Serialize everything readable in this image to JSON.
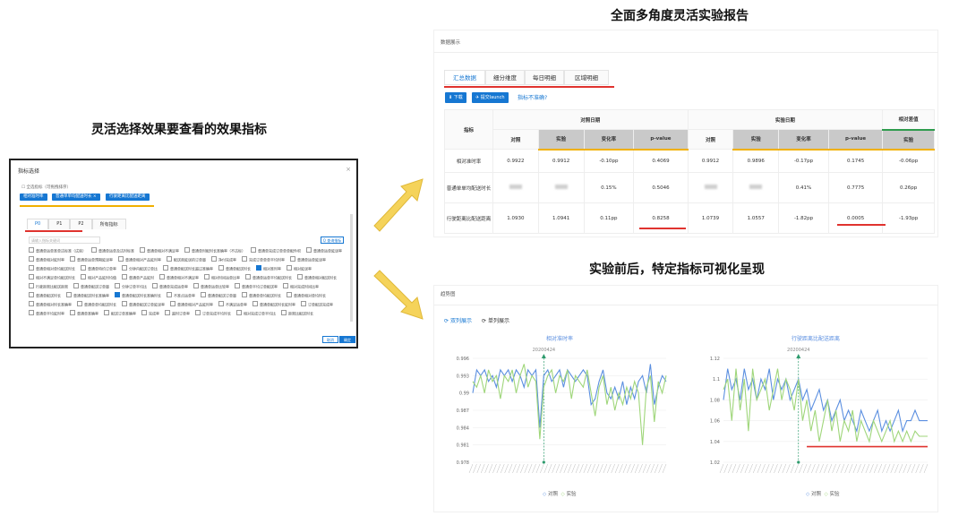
{
  "captions": {
    "left": "灵活选择效果要查看的效果指标",
    "top": "全面多角度灵活实验报告",
    "middle": "实验前后，特定指标可视化呈现"
  },
  "dialog": {
    "title": "指标选择",
    "close": "×",
    "checkbox": "☐ 全选指标（可拖拽排序）",
    "tags": [
      "相对准时率",
      "普通单单均配送时长 ×",
      "行驶距离比配送距离"
    ],
    "tabs": [
      "P0",
      "P1",
      "P2",
      "所有指标"
    ],
    "search_placeholder": "请输入指标关键词",
    "search_button": "Q 查询指标",
    "options": [
      "普通单运单准单达标准（试验）",
      "普通单运单及达时标准",
      "普通单相对不满足率",
      "普通单时配时长准确率（不达标）",
      "普通单完成订单单单配件积",
      "普通单运单延误率",
      "普通单相对延时率",
      "普通单运单预期延误率",
      "普通单相对产品延时率",
      "配送商延误的订单量",
      "净付完成率",
      "完成订单单单平均时率",
      "普通单运单延误率",
      "普通单相对单均配送时长",
      "普通单特约订单率",
      "分钟内配送订单比",
      "普通单配送时长超过准确率",
      "普通单配送时长",
      "相对准时率",
      "相对延误率",
      "相对不满足单均配送时长",
      "相对产品延时均值",
      "普通单产品延时",
      "普通单相对不满足率",
      "相对时间运单比率",
      "普通单运单平均配送时长",
      "普通单相对配送时长",
      "行驶距离比配送距离",
      "普通单配送订单量",
      "分钟订单平均比",
      "普通单完成运单率",
      "普通单运单比较率",
      "普通单平均订单配送率",
      "相对完成时间比率",
      "普通单配送时长",
      "普通单配送时长准确率",
      "普通单配送时长准确时长",
      "不准点运单率",
      "普通单配送订单量",
      "普通单单均配送时长",
      "普通单相对单均时长",
      "普通单相对时长准确率",
      "普通单单均配送时长",
      "普通单配送订单延误率",
      "普通单相对产品延时率",
      "不满足运单率",
      "普通单配送时长延时率",
      "订单配送完成率",
      "普通单平均延时率",
      "普通单准确率",
      "配送订单准确率",
      "完成率",
      "超时订单率",
      "订单完成平均时长",
      "相对完成订单平均比",
      "距离比配送时长"
    ],
    "options_on": [
      18,
      36
    ],
    "cancel": "取消",
    "ok": "确定"
  },
  "report": {
    "section": "数据展示",
    "tabs": [
      "汇总数据",
      "细分维度",
      "每日明细",
      "区域明细"
    ],
    "download": "⬇ 下载",
    "submit": "✈ 提交launch",
    "inaccurate": "指标不准确?",
    "headers": {
      "metric": "指标",
      "group_control": "对照日期",
      "group_exp": "实验日期",
      "group_rel": "相对差值",
      "cols": [
        "对照",
        "实验",
        "变化率",
        "p-value",
        "对照",
        "实验",
        "变化率",
        "p-value",
        "实验"
      ]
    },
    "rows": [
      {
        "name": "相对准时率",
        "cells": [
          "0.9922",
          "0.9912",
          "-0.10pp",
          "0.4069",
          "0.9912",
          "0.9896",
          "-0.17pp",
          "0.1745",
          "-0.06pp"
        ]
      },
      {
        "name": "普通单单均配送时长",
        "cells": [
          "",
          "",
          "0.15%",
          "0.5046",
          "",
          "",
          "0.41%",
          "0.7775",
          "0.26pp"
        ]
      },
      {
        "name": "行驶距离比配送距离",
        "cells": [
          "1.0930",
          "1.0941",
          "0.11pp",
          "0.8258",
          "1.0739",
          "1.0557",
          "-1.82pp",
          "0.0005",
          "-1.93pp"
        ]
      }
    ]
  },
  "trend": {
    "section": "趋势图",
    "toggle_1": "双列展示",
    "toggle_2": "单列展示",
    "legend": [
      "对照",
      "实验"
    ],
    "colors": {
      "control": "#5b8fe0",
      "exp": "#9fd67a",
      "marker": "#2e9b6d",
      "threshold": "#e0332f"
    }
  },
  "chart_data": [
    {
      "type": "line",
      "title": "相对准时率",
      "annotation": "20200424",
      "yticks": [
        "0.996",
        "0.993",
        "0.99",
        "0.987",
        "0.984",
        "0.981",
        "0.978"
      ],
      "ylim": [
        0.978,
        0.996
      ],
      "series": [
        {
          "name": "对照",
          "values": [
            0.99,
            0.994,
            0.993,
            0.994,
            0.992,
            0.993,
            0.991,
            0.994,
            0.993,
            0.994,
            0.992,
            0.994,
            0.993,
            0.991,
            0.994,
            0.993,
            0.994,
            0.984,
            0.993,
            0.994,
            0.992,
            0.993,
            0.994,
            0.991,
            0.994,
            0.993,
            0.992,
            0.993,
            0.994,
            0.993,
            0.988,
            0.989,
            0.992,
            0.994,
            0.99,
            0.989,
            0.991,
            0.989,
            0.992,
            0.988,
            0.991,
            0.989,
            0.992,
            0.993,
            0.99,
            0.995,
            0.988,
            0.991,
            0.993,
            0.992
          ]
        },
        {
          "name": "实验",
          "values": [
            0.992,
            0.991,
            0.993,
            0.99,
            0.994,
            0.992,
            0.993,
            0.989,
            0.993,
            0.992,
            0.994,
            0.99,
            0.993,
            0.995,
            0.991,
            0.993,
            0.992,
            0.982,
            0.991,
            0.993,
            0.994,
            0.99,
            0.993,
            0.992,
            0.994,
            0.989,
            0.993,
            0.992,
            0.991,
            0.994,
            0.99,
            0.986,
            0.991,
            0.993,
            0.988,
            0.991,
            0.987,
            0.99,
            0.988,
            0.991,
            0.989,
            0.992,
            0.99,
            0.981,
            0.991,
            0.993,
            0.985,
            0.992,
            0.99,
            0.993
          ]
        }
      ]
    },
    {
      "type": "line",
      "title": "行驶距离比配送距离",
      "annotation": "20200424",
      "yticks": [
        "1.12",
        "1.1",
        "1.08",
        "1.06",
        "1.04",
        "1.02"
      ],
      "ylim": [
        1.02,
        1.12
      ],
      "series": [
        {
          "name": "对照",
          "values": [
            1.08,
            1.11,
            1.09,
            1.1,
            1.08,
            1.11,
            1.09,
            1.1,
            1.08,
            1.1,
            1.09,
            1.11,
            1.08,
            1.1,
            1.09,
            1.1,
            1.08,
            1.09,
            1.1,
            1.08,
            1.09,
            1.07,
            1.08,
            1.09,
            1.07,
            1.08,
            1.06,
            1.07,
            1.08,
            1.06,
            1.07,
            1.06,
            1.05,
            1.07,
            1.06,
            1.05,
            1.06,
            1.07,
            1.05,
            1.06,
            1.05,
            1.06,
            1.07,
            1.05,
            1.06,
            1.06,
            1.07,
            1.06,
            1.06,
            1.06
          ]
        },
        {
          "name": "实验",
          "values": [
            1.09,
            1.1,
            1.06,
            1.11,
            1.07,
            1.1,
            1.05,
            1.11,
            1.08,
            1.09,
            1.1,
            1.07,
            1.09,
            1.11,
            1.08,
            1.1,
            1.09,
            1.07,
            1.1,
            1.06,
            1.08,
            1.05,
            1.07,
            1.04,
            1.06,
            1.08,
            1.05,
            1.07,
            1.04,
            1.06,
            1.05,
            1.07,
            1.04,
            1.06,
            1.05,
            1.04,
            1.06,
            1.05,
            1.04,
            1.05,
            1.06,
            1.04,
            1.05,
            1.04,
            1.05,
            1.04,
            1.05,
            1.045,
            1.045,
            1.045
          ]
        }
      ],
      "threshold": 1.035
    }
  ]
}
